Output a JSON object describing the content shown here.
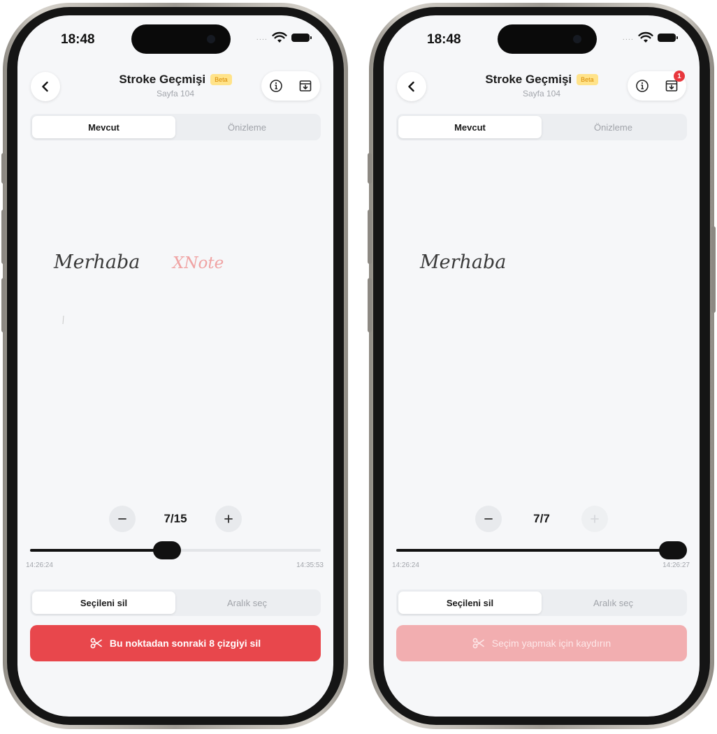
{
  "colors": {
    "accent_red": "#e8474c",
    "accent_red_disabled": "#f2aeb0",
    "beta_bg": "#ffe38a",
    "beta_text": "#d98a00",
    "ink_black": "#3a3a3a",
    "ink_preview_red": "#f0a3a3",
    "badge_red": "#e8373d"
  },
  "screens": [
    {
      "status": {
        "time": "18:48",
        "signal": "....",
        "icons": [
          "wifi-icon",
          "battery-icon"
        ]
      },
      "header": {
        "back_icon": "chevron-left-icon",
        "title": "Stroke Geçmişi",
        "badge": "Beta",
        "subtitle": "Sayfa 104",
        "info_icon": "info-icon",
        "archive_icon": "archive-download-icon",
        "archive_badge": ""
      },
      "tabs": [
        {
          "label": "Mevcut",
          "active": true
        },
        {
          "label": "Önizleme",
          "active": false
        }
      ],
      "canvas": {
        "handwriting": "Merhaba",
        "preview_handwriting": "XNote"
      },
      "stepper": {
        "counter": "7/15",
        "minus_icon": "minus-icon",
        "plus_icon": "plus-icon",
        "plus_enabled": true
      },
      "slider": {
        "position": 0.47,
        "start_time": "14:26:24",
        "end_time": "14:35:53"
      },
      "modes": [
        {
          "label": "Seçileni sil",
          "active": true
        },
        {
          "label": "Aralık seç",
          "active": false
        }
      ],
      "action": {
        "icon": "scissors-icon",
        "label": "Bu noktadan sonraki 8 çizgiyi sil",
        "enabled": true
      }
    },
    {
      "status": {
        "time": "18:48",
        "signal": "....",
        "icons": [
          "wifi-icon",
          "battery-icon"
        ]
      },
      "header": {
        "back_icon": "chevron-left-icon",
        "title": "Stroke Geçmişi",
        "badge": "Beta",
        "subtitle": "Sayfa 104",
        "info_icon": "info-icon",
        "archive_icon": "archive-download-icon",
        "archive_badge": "1"
      },
      "tabs": [
        {
          "label": "Mevcut",
          "active": true
        },
        {
          "label": "Önizleme",
          "active": false
        }
      ],
      "canvas": {
        "handwriting": "Merhaba",
        "preview_handwriting": ""
      },
      "stepper": {
        "counter": "7/7",
        "minus_icon": "minus-icon",
        "plus_icon": "plus-icon",
        "plus_enabled": false
      },
      "slider": {
        "position": 1.0,
        "start_time": "14:26:24",
        "end_time": "14:26:27"
      },
      "modes": [
        {
          "label": "Seçileni sil",
          "active": true
        },
        {
          "label": "Aralık seç",
          "active": false
        }
      ],
      "action": {
        "icon": "scissors-icon",
        "label": "Seçim yapmak için kaydırın",
        "enabled": false
      }
    }
  ]
}
